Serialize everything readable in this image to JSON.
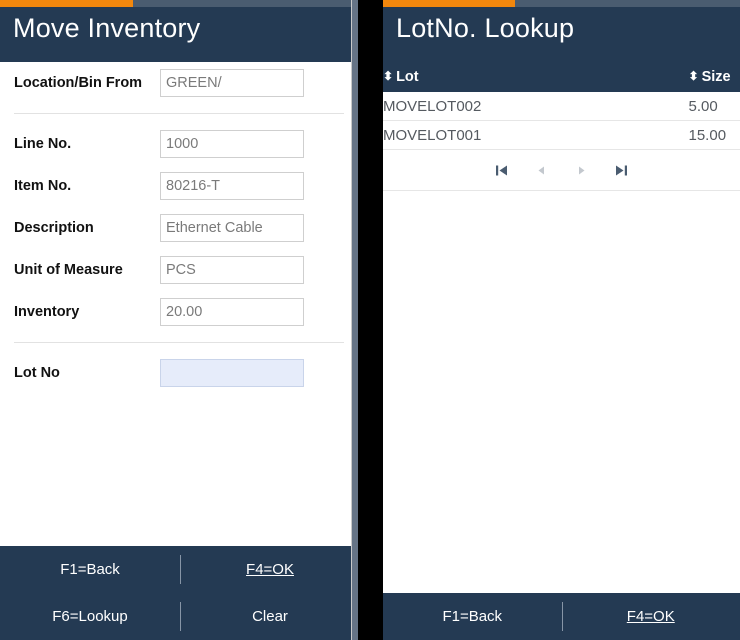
{
  "colors": {
    "accent_orange": "#f2870d",
    "accent_track": "#4a5c70",
    "panel_header": "#243a53",
    "focus_field": "#e6ecfa",
    "text_muted": "#7a7a7a"
  },
  "left_panel": {
    "progress_percent": 37,
    "title": "Move Inventory",
    "fields": [
      {
        "label": "Location/Bin From",
        "value": "GREEN/",
        "focused": false
      },
      {
        "label": "Line No.",
        "value": "1000",
        "focused": false
      },
      {
        "label": "Item No.",
        "value": "80216-T",
        "focused": false
      },
      {
        "label": "Description",
        "value": "Ethernet Cable",
        "focused": false
      },
      {
        "label": "Unit of Measure",
        "value": "PCS",
        "focused": false
      },
      {
        "label": "Inventory",
        "value": "20.00",
        "focused": false
      },
      {
        "label": "Lot No",
        "value": "",
        "focused": true
      }
    ],
    "footer": {
      "back_label": "F1=Back",
      "ok_label": "F4=OK",
      "lookup_label": "F6=Lookup",
      "clear_label": "Clear"
    }
  },
  "right_panel": {
    "progress_percent": 37,
    "title": "LotNo. Lookup",
    "table": {
      "sort_icon": "⬍",
      "columns": [
        "Lot",
        "Size"
      ],
      "rows": [
        {
          "lot": "MOVELOT002",
          "size": "5.00"
        },
        {
          "lot": "MOVELOT001",
          "size": "15.00"
        }
      ]
    },
    "pager": {
      "first_label": "first-page",
      "prev_label": "previous-page",
      "next_label": "next-page",
      "last_label": "last-page"
    },
    "footer": {
      "back_label": "F1=Back",
      "ok_label": "F4=OK"
    }
  }
}
